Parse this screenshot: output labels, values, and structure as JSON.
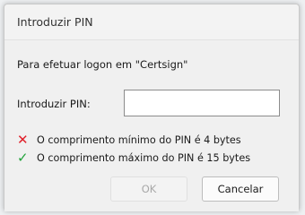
{
  "dialog": {
    "title": "Introduzir PIN",
    "prompt": "Para efetuar logon em \"Certsign\"",
    "pin_label": "Introduzir PIN:",
    "pin_value": "",
    "rules": [
      {
        "icon": "cross-icon",
        "glyph": "✕",
        "status_color": "#e0202a",
        "text": "O comprimento mínimo do PIN é 4 bytes"
      },
      {
        "icon": "check-icon",
        "glyph": "✓",
        "status_color": "#22a33b",
        "text": "O comprimento máximo do PIN é 15 bytes"
      }
    ],
    "ok_label": "OK",
    "cancel_label": "Cancelar"
  }
}
